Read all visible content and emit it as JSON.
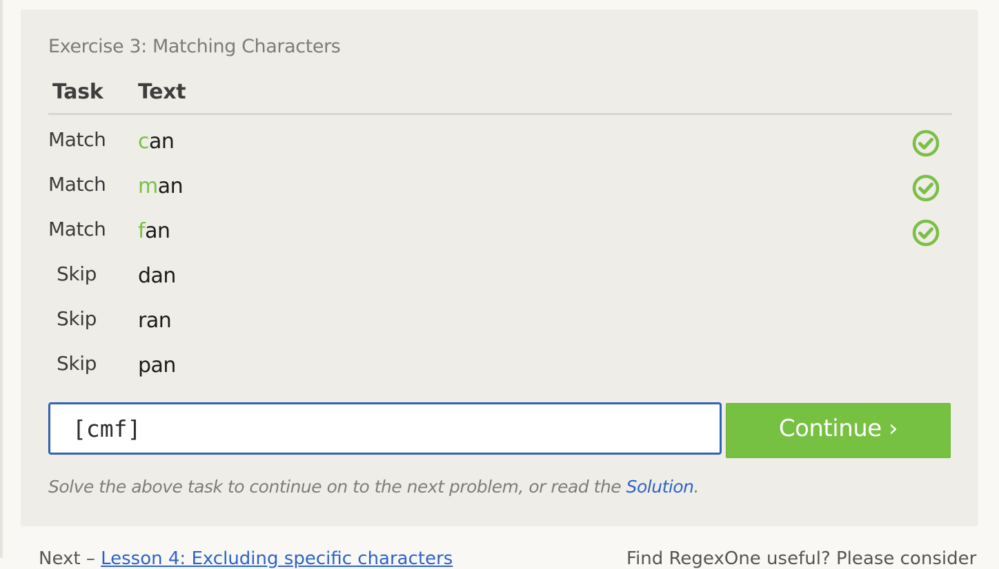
{
  "exercise": {
    "title": "Exercise 3: Matching Characters",
    "columns": {
      "task": "Task",
      "text": "Text"
    },
    "rows": [
      {
        "task": "Match",
        "highlight": "c",
        "rest": "an",
        "status": "check-circle-icon"
      },
      {
        "task": "Match",
        "highlight": "m",
        "rest": "an",
        "status": "check-circle-icon"
      },
      {
        "task": "Match",
        "highlight": "f",
        "rest": "an",
        "status": "check-circle-icon"
      },
      {
        "task": "Skip",
        "highlight": "",
        "rest": "dan",
        "status": ""
      },
      {
        "task": "Skip",
        "highlight": "",
        "rest": "ran",
        "status": ""
      },
      {
        "task": "Skip",
        "highlight": "",
        "rest": "pan",
        "status": ""
      }
    ],
    "input": {
      "value": "[cmf]"
    },
    "continue_label": "Continue ›",
    "hint": {
      "before": "Solve the above task to continue on to the next problem, or read the ",
      "link": "Solution",
      "after": "."
    }
  },
  "footer": {
    "next_prefix": "Next – ",
    "next_link": "Lesson 4: Excluding specific characters",
    "support_text": "Find RegexOne useful? Please consider"
  },
  "colors": {
    "match_highlight": "#79c142",
    "check_icon": "#7bbf45",
    "continue_bg": "#77c142",
    "input_border": "#2f62b4",
    "link": "#2d63c8"
  }
}
